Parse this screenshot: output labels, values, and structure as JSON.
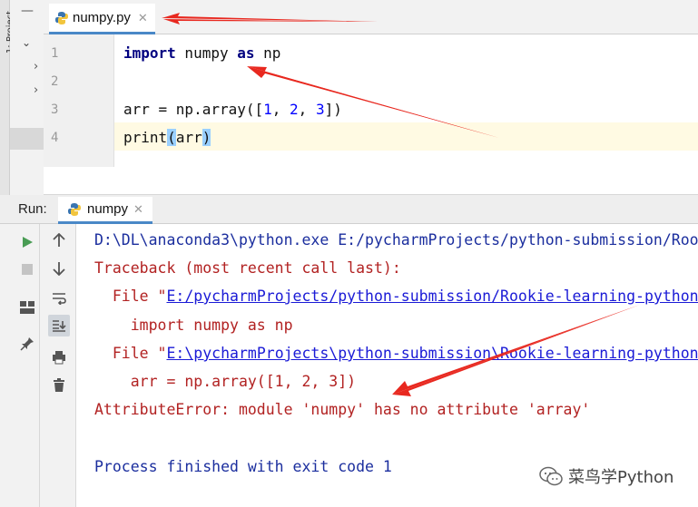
{
  "sidebar": {
    "project_label": "1: Project"
  },
  "editor": {
    "tab": {
      "label": "numpy.py"
    },
    "line_numbers": [
      "1",
      "2",
      "3",
      "4"
    ],
    "code": {
      "line1": {
        "kw_import": "import",
        "module": " numpy ",
        "kw_as": "as",
        "alias": " np"
      },
      "line3": {
        "prefix": "arr = np.array([",
        "n1": "1",
        "sep1": ", ",
        "n2": "2",
        "sep2": ", ",
        "n3": "3",
        "suffix": "])"
      },
      "line4": {
        "func": "print",
        "open": "(",
        "arg": "arr",
        "close": ")"
      }
    }
  },
  "run": {
    "label": "Run:",
    "tab_label": "numpy"
  },
  "console": {
    "cmd": "D:\\DL\\anaconda3\\python.exe E:/pycharmProjects/python-submission/Roo",
    "traceback": "Traceback (most recent call last):",
    "file1_prefix": "  File \"",
    "file1_link": "E:/pycharmProjects/python-submission/Rookie-learning-python",
    "code1": "    import numpy as np",
    "file2_prefix": "  File \"",
    "file2_link": "E:\\pycharmProjects\\python-submission\\Rookie-learning-python",
    "code2": "    arr = np.array([1, 2, 3])",
    "error": "AttributeError: module 'numpy' has no attribute 'array'",
    "exit": "Process finished with exit code 1"
  },
  "watermark": {
    "text": "菜鸟学Python"
  },
  "colors": {
    "arrow": "#e8281f",
    "console_blue": "#1b2e9e",
    "console_red": "#b22222",
    "link": "#1a1ad6"
  }
}
